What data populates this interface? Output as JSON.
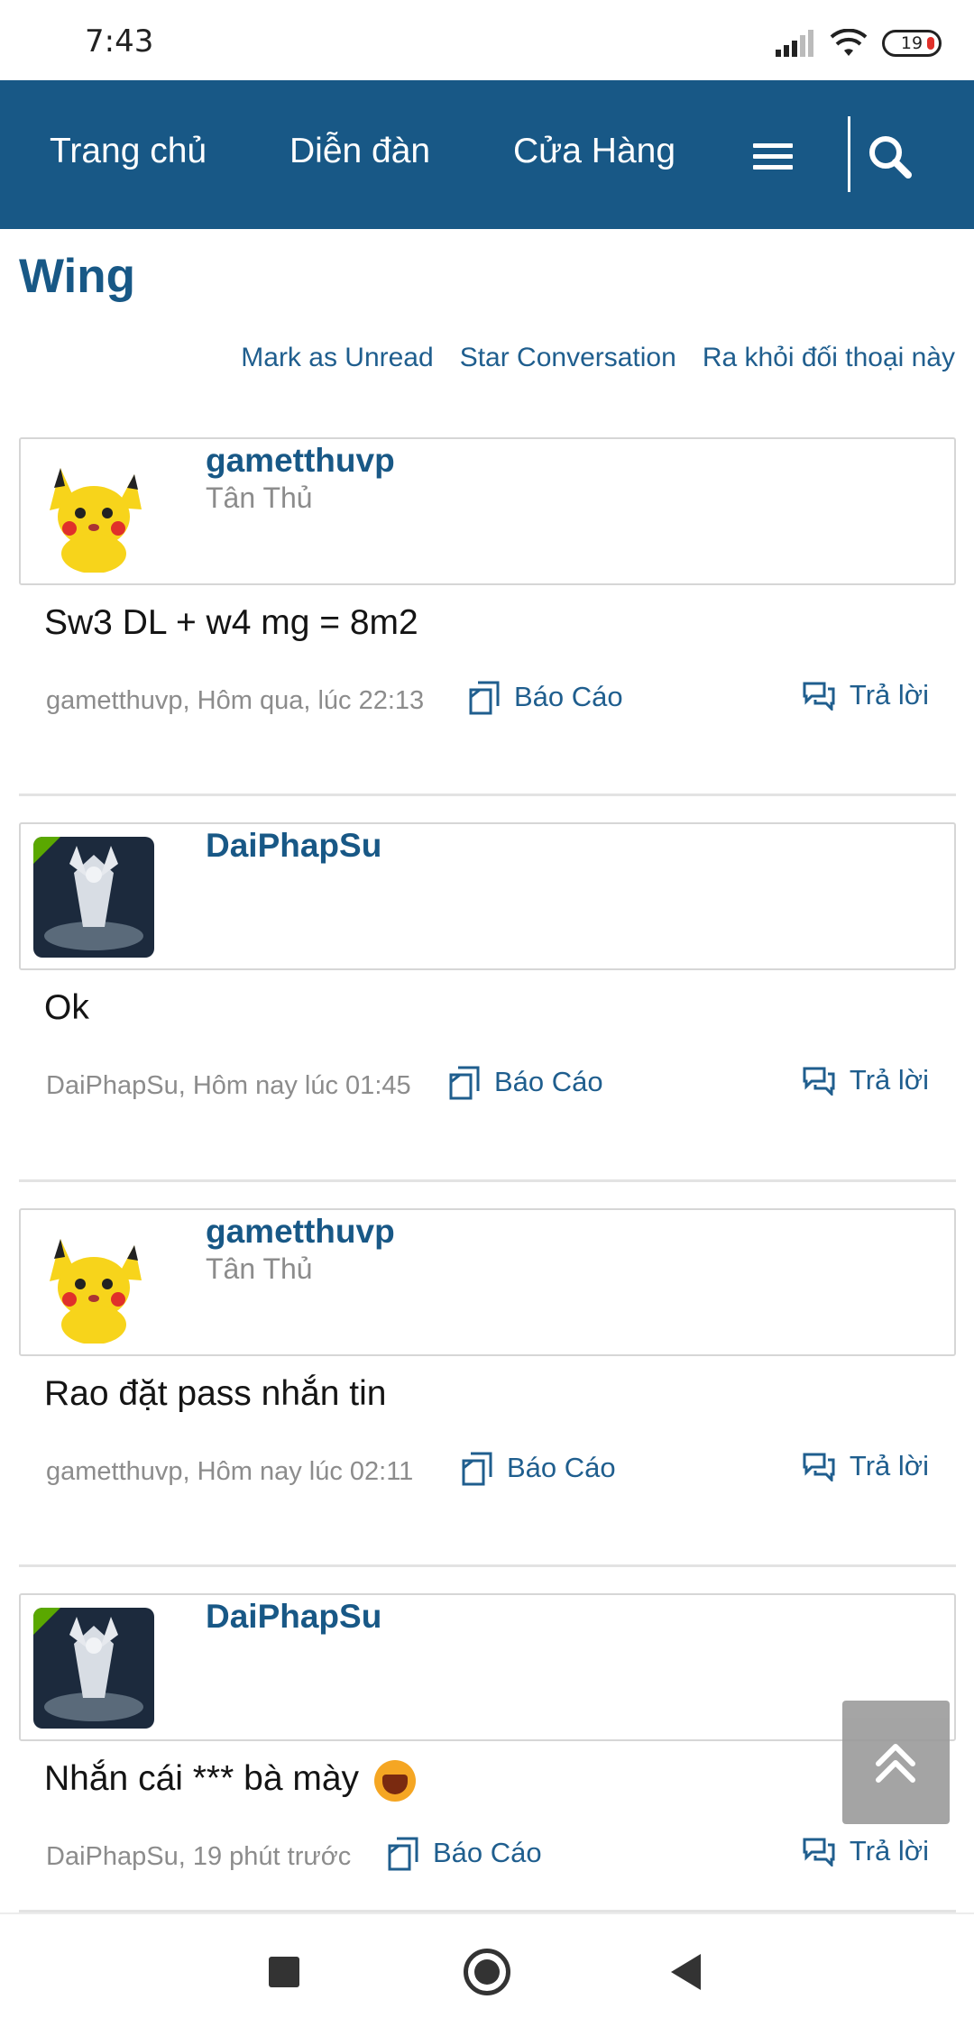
{
  "status_bar": {
    "time": "7:43",
    "battery": "19"
  },
  "navbar": {
    "links": [
      "Trang chủ",
      "Diễn đàn",
      "Cửa Hàng"
    ],
    "menu_icon": "hamburger-icon",
    "search_icon": "search-icon",
    "color": "#185886"
  },
  "page": {
    "title": "Wing",
    "actions": [
      "Mark as Unread",
      "Star Conversation",
      "Ra khỏi đối thoại này"
    ]
  },
  "messages": [
    {
      "username": "gametthuvp",
      "user_title": "Tân Thủ",
      "avatar": "pikachu-avatar",
      "text": "Sw3 DL + w4 mg = 8m2",
      "meta": "gametthuvp, Hôm qua, lúc 22:13",
      "report_label": "Báo Cáo",
      "reply_label": "Trả lời"
    },
    {
      "username": "DaiPhapSu",
      "user_title": "",
      "avatar": "warrior-avatar",
      "text": "Ok",
      "meta": "DaiPhapSu, Hôm nay lúc 01:45",
      "report_label": "Báo Cáo",
      "reply_label": "Trả lời"
    },
    {
      "username": "gametthuvp",
      "user_title": "Tân Thủ",
      "avatar": "pikachu-avatar",
      "text": "Rao đặt pass nhắn tin",
      "meta": "gametthuvp, Hôm nay lúc 02:11",
      "report_label": "Báo Cáo",
      "reply_label": "Trả lời"
    },
    {
      "username": "DaiPhapSu",
      "user_title": "",
      "avatar": "warrior-avatar",
      "text": "Nhắn cái *** bà mày",
      "meta": "DaiPhapSu, 19 phút trước",
      "report_label": "Báo Cáo",
      "reply_label": "Trả lời"
    }
  ],
  "back_to_top_icon": "double-chevron-up-icon",
  "system_nav": {
    "recents": "square-icon",
    "home": "circle-home-icon",
    "back": "triangle-back-icon"
  }
}
